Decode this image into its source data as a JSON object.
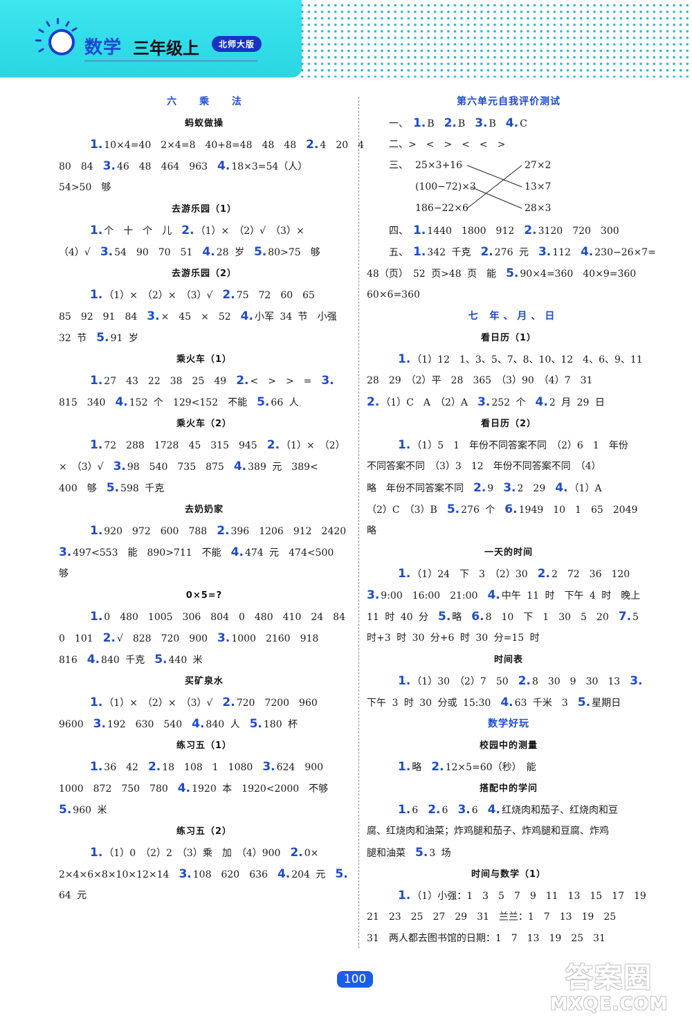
{
  "header": {
    "subject": "数学",
    "grade": "三年级上",
    "edition": "北师大版"
  },
  "left": {
    "unit_title": "六 乘 法",
    "sections": [
      {
        "title": "蚂蚁做操",
        "lines": [
          [
            [
              "1.",
              "10×4=40　2×4=8　40+8=48　48　48"
            ],
            [
              "2.",
              "4　20　4"
            ]
          ],
          [
            [
              "",
              "80　84"
            ],
            [
              "3.",
              "46　48　464　963"
            ],
            [
              "4.",
              "18×3=54（人）"
            ]
          ],
          [
            [
              "",
              "54>50　够"
            ]
          ]
        ]
      },
      {
        "title": "去游乐园（1）",
        "lines": [
          [
            [
              "1.",
              "个　十　个　儿"
            ],
            [
              "2.",
              "（1）×　（2）√　（3）×"
            ]
          ],
          [
            [
              "",
              "（4）√"
            ],
            [
              "3.",
              "54　90　70　51"
            ],
            [
              "4.",
              "28 岁"
            ],
            [
              "5.",
              "80>75　够"
            ]
          ]
        ]
      },
      {
        "title": "去游乐园（2）",
        "lines": [
          [
            [
              "1.",
              "（1）×　（2）×　（3）√"
            ],
            [
              "2.",
              "75　72　60　65"
            ]
          ],
          [
            [
              "",
              "85　92　91　84"
            ],
            [
              "3.",
              "×　45　×　52"
            ],
            [
              "4.",
              "小军 34 节　小强"
            ]
          ],
          [
            [
              "",
              "32 节"
            ],
            [
              "5.",
              "91 岁"
            ]
          ]
        ]
      },
      {
        "title": "乘火车（1）",
        "lines": [
          [
            [
              "1.",
              "27　43　22　38　25　49"
            ],
            [
              "2.",
              "<　>　>　="
            ],
            [
              "3.",
              ""
            ]
          ],
          [
            [
              "",
              "815　340"
            ],
            [
              "4.",
              "152 个　129<152　不能"
            ],
            [
              "5.",
              "66 人"
            ]
          ]
        ]
      },
      {
        "title": "乘火车（2）",
        "lines": [
          [
            [
              "1.",
              "72　288　1728　45　315　945"
            ],
            [
              "2.",
              "（1）×　（2）"
            ]
          ],
          [
            [
              "",
              "×　（3）√"
            ],
            [
              "3.",
              "98　540　735　875"
            ],
            [
              "4.",
              "389 元　389<"
            ]
          ],
          [
            [
              "",
              "400　够"
            ],
            [
              "5.",
              "598 千克"
            ]
          ]
        ]
      },
      {
        "title": "去奶奶家",
        "lines": [
          [
            [
              "1.",
              "920　972　600　788"
            ],
            [
              "2.",
              "396　1206　912　2420"
            ]
          ],
          [
            [
              "3.",
              "497<553　能　890>711　不能"
            ],
            [
              "4.",
              "474 元　474<500"
            ]
          ],
          [
            [
              "",
              "够"
            ]
          ]
        ]
      },
      {
        "title": "0×5=?",
        "lines": [
          [
            [
              "1.",
              "0　480　1005　306　804　0　480　410　24　84"
            ]
          ],
          [
            [
              "",
              "0　101"
            ],
            [
              "2.",
              "√　828　720　900"
            ],
            [
              "3.",
              "1000　2160　918"
            ]
          ],
          [
            [
              "",
              "816"
            ],
            [
              "4.",
              "840 千克"
            ],
            [
              "5.",
              "440 米"
            ]
          ]
        ]
      },
      {
        "title": "买矿泉水",
        "lines": [
          [
            [
              "1.",
              "（1）×　（2）×　（3）√"
            ],
            [
              "2.",
              "720　7200　960"
            ]
          ],
          [
            [
              "",
              "9600"
            ],
            [
              "3.",
              "192　630　540"
            ],
            [
              "4.",
              "840 人"
            ],
            [
              "5.",
              "180 杯"
            ]
          ]
        ]
      },
      {
        "title": "练习五（1）",
        "lines": [
          [
            [
              "1.",
              "36　42"
            ],
            [
              "2.",
              "18　108　1　1080"
            ],
            [
              "3.",
              "624　900"
            ]
          ],
          [
            [
              "",
              "1000　872　750　780"
            ],
            [
              "4.",
              "1920 本　1920<2000　不够"
            ]
          ],
          [
            [
              "5.",
              "960 米"
            ]
          ]
        ]
      },
      {
        "title": "练习五（2）",
        "lines": [
          [
            [
              "1.",
              "（1）0　（2）2　（3）乘　加　（4）900"
            ],
            [
              "2.",
              "0×"
            ]
          ],
          [
            [
              "",
              "2×4×6×8×10×12×14"
            ],
            [
              "3.",
              "108　620　636"
            ],
            [
              "4.",
              "204 元"
            ],
            [
              "5.",
              ""
            ]
          ],
          [
            [
              "",
              "64 元"
            ]
          ]
        ]
      }
    ]
  },
  "right": {
    "test_title": "第六单元自我评价测试",
    "test": {
      "q1": [
        [
          "一、",
          ""
        ],
        [
          "1.",
          "B"
        ],
        [
          "2.",
          "B"
        ],
        [
          "3.",
          "B"
        ],
        [
          "4.",
          "C"
        ]
      ],
      "q2": "二、>　<　>　<　<　>",
      "q3": {
        "prefix": "三、",
        "left": [
          "25×3+16",
          "(100−72)×3",
          "186−22×6"
        ],
        "right": [
          "27×2",
          "13×7",
          "28×3"
        ],
        "links": [
          [
            0,
            1
          ],
          [
            1,
            2
          ],
          [
            2,
            0
          ]
        ]
      },
      "q4": [
        [
          "四、",
          ""
        ],
        [
          "1.",
          "1440　1800　912"
        ],
        [
          "2.",
          "3120　720　300"
        ]
      ],
      "q5": [
        [
          [
            "五、",
            ""
          ],
          [
            "1.",
            "342 千克"
          ],
          [
            "2.",
            "276 元"
          ],
          [
            "3.",
            "112"
          ],
          [
            "4.",
            "230−26×7="
          ]
        ],
        [
          [
            "",
            "48（页）　52 页>48 页　能"
          ],
          [
            "5.",
            "90×4=360　40×9=360"
          ]
        ],
        [
          [
            "",
            "60×6=360"
          ]
        ]
      ]
    },
    "unit7_title": "七 年、月、日",
    "sections": [
      {
        "title": "看日历（1）",
        "lines": [
          [
            [
              "1.",
              "（1）12　1、3、5、7、8、10、12　4、6、9、11"
            ]
          ],
          [
            [
              "",
              "28　29　（2）平　28　365　（3）90　（4）7　31"
            ]
          ],
          [
            [
              "2.",
              "（1）C　A　（2）A"
            ],
            [
              "3.",
              "252 个"
            ],
            [
              "4.",
              "2 月 29 日"
            ]
          ]
        ]
      },
      {
        "title": "看日历（2）",
        "lines": [
          [
            [
              "1.",
              "（1）5　1　年份不同答案不同　（2）6　1　年份"
            ]
          ],
          [
            [
              "",
              "不同答案不同　（3）3　12　年份不同答案不同　（4）"
            ]
          ],
          [
            [
              "",
              "略　年份不同答案不同"
            ],
            [
              "2.",
              "9"
            ],
            [
              "3.",
              "2　29"
            ],
            [
              "4.",
              "（1）A"
            ]
          ],
          [
            [
              "",
              "（2）C　（3）B"
            ],
            [
              "5.",
              "276 个"
            ],
            [
              "6.",
              "1949　10　1　65　2049"
            ]
          ],
          [
            [
              "",
              "略"
            ]
          ]
        ]
      },
      {
        "title": "一天的时间",
        "lines": [
          [
            [
              "1.",
              "（1）24　下　3　（2）30"
            ],
            [
              "2.",
              "2　72　36　120"
            ]
          ],
          [
            [
              "3.",
              "9:00　16:00　21:00"
            ],
            [
              "4.",
              "中午 11 时　下午 4 时　晚上"
            ]
          ],
          [
            [
              "",
              "11 时 40 分"
            ],
            [
              "5.",
              "略"
            ],
            [
              "6.",
              "8　10　下　1　30　5　20"
            ],
            [
              "7.",
              "5"
            ]
          ],
          [
            [
              "",
              "时+3 时 30 分+6 时 30 分=15 时"
            ]
          ]
        ]
      },
      {
        "title": "时间表",
        "lines": [
          [
            [
              "1.",
              "（1）30　（2）7　50"
            ],
            [
              "2.",
              "8　30　9　30　13"
            ],
            [
              "3.",
              ""
            ]
          ],
          [
            [
              "",
              "下午 3 时 30 分或 15:30"
            ],
            [
              "4.",
              "63 千米　3"
            ],
            [
              "5.",
              "星期日"
            ]
          ]
        ]
      }
    ],
    "fun_title": "数学好玩",
    "fun_sections": [
      {
        "title": "校园中的测量",
        "lines": [
          [
            [
              "1.",
              "略"
            ],
            [
              "2.",
              "12×5=60（秒）　能"
            ]
          ]
        ]
      },
      {
        "title": "搭配中的学问",
        "lines": [
          [
            [
              "1.",
              "6"
            ],
            [
              "2.",
              "6"
            ],
            [
              "3.",
              "6"
            ],
            [
              "4.",
              "红烧肉和茄子、红烧肉和豆"
            ]
          ],
          [
            [
              "",
              "腐、红烧肉和油菜；炸鸡腿和茄子、炸鸡腿和豆腐、炸鸡"
            ]
          ],
          [
            [
              "",
              "腿和油菜"
            ],
            [
              "5.",
              "3 场"
            ]
          ]
        ]
      },
      {
        "title": "时间与数学（1）",
        "lines": [
          [
            [
              "1.",
              "（1）小强：1　3　5　7　9　11　13　15　17　19"
            ]
          ],
          [
            [
              "",
              "21　23　25　27　29　31　兰兰：1　7　13　19　25"
            ]
          ],
          [
            [
              "",
              "31　两人都去图书馆的日期：1　7　13　19　25　31"
            ]
          ]
        ]
      }
    ]
  },
  "footer": {
    "page_number": "100",
    "watermark_cn": "答案圈",
    "watermark_en": "MXQE.COM"
  }
}
